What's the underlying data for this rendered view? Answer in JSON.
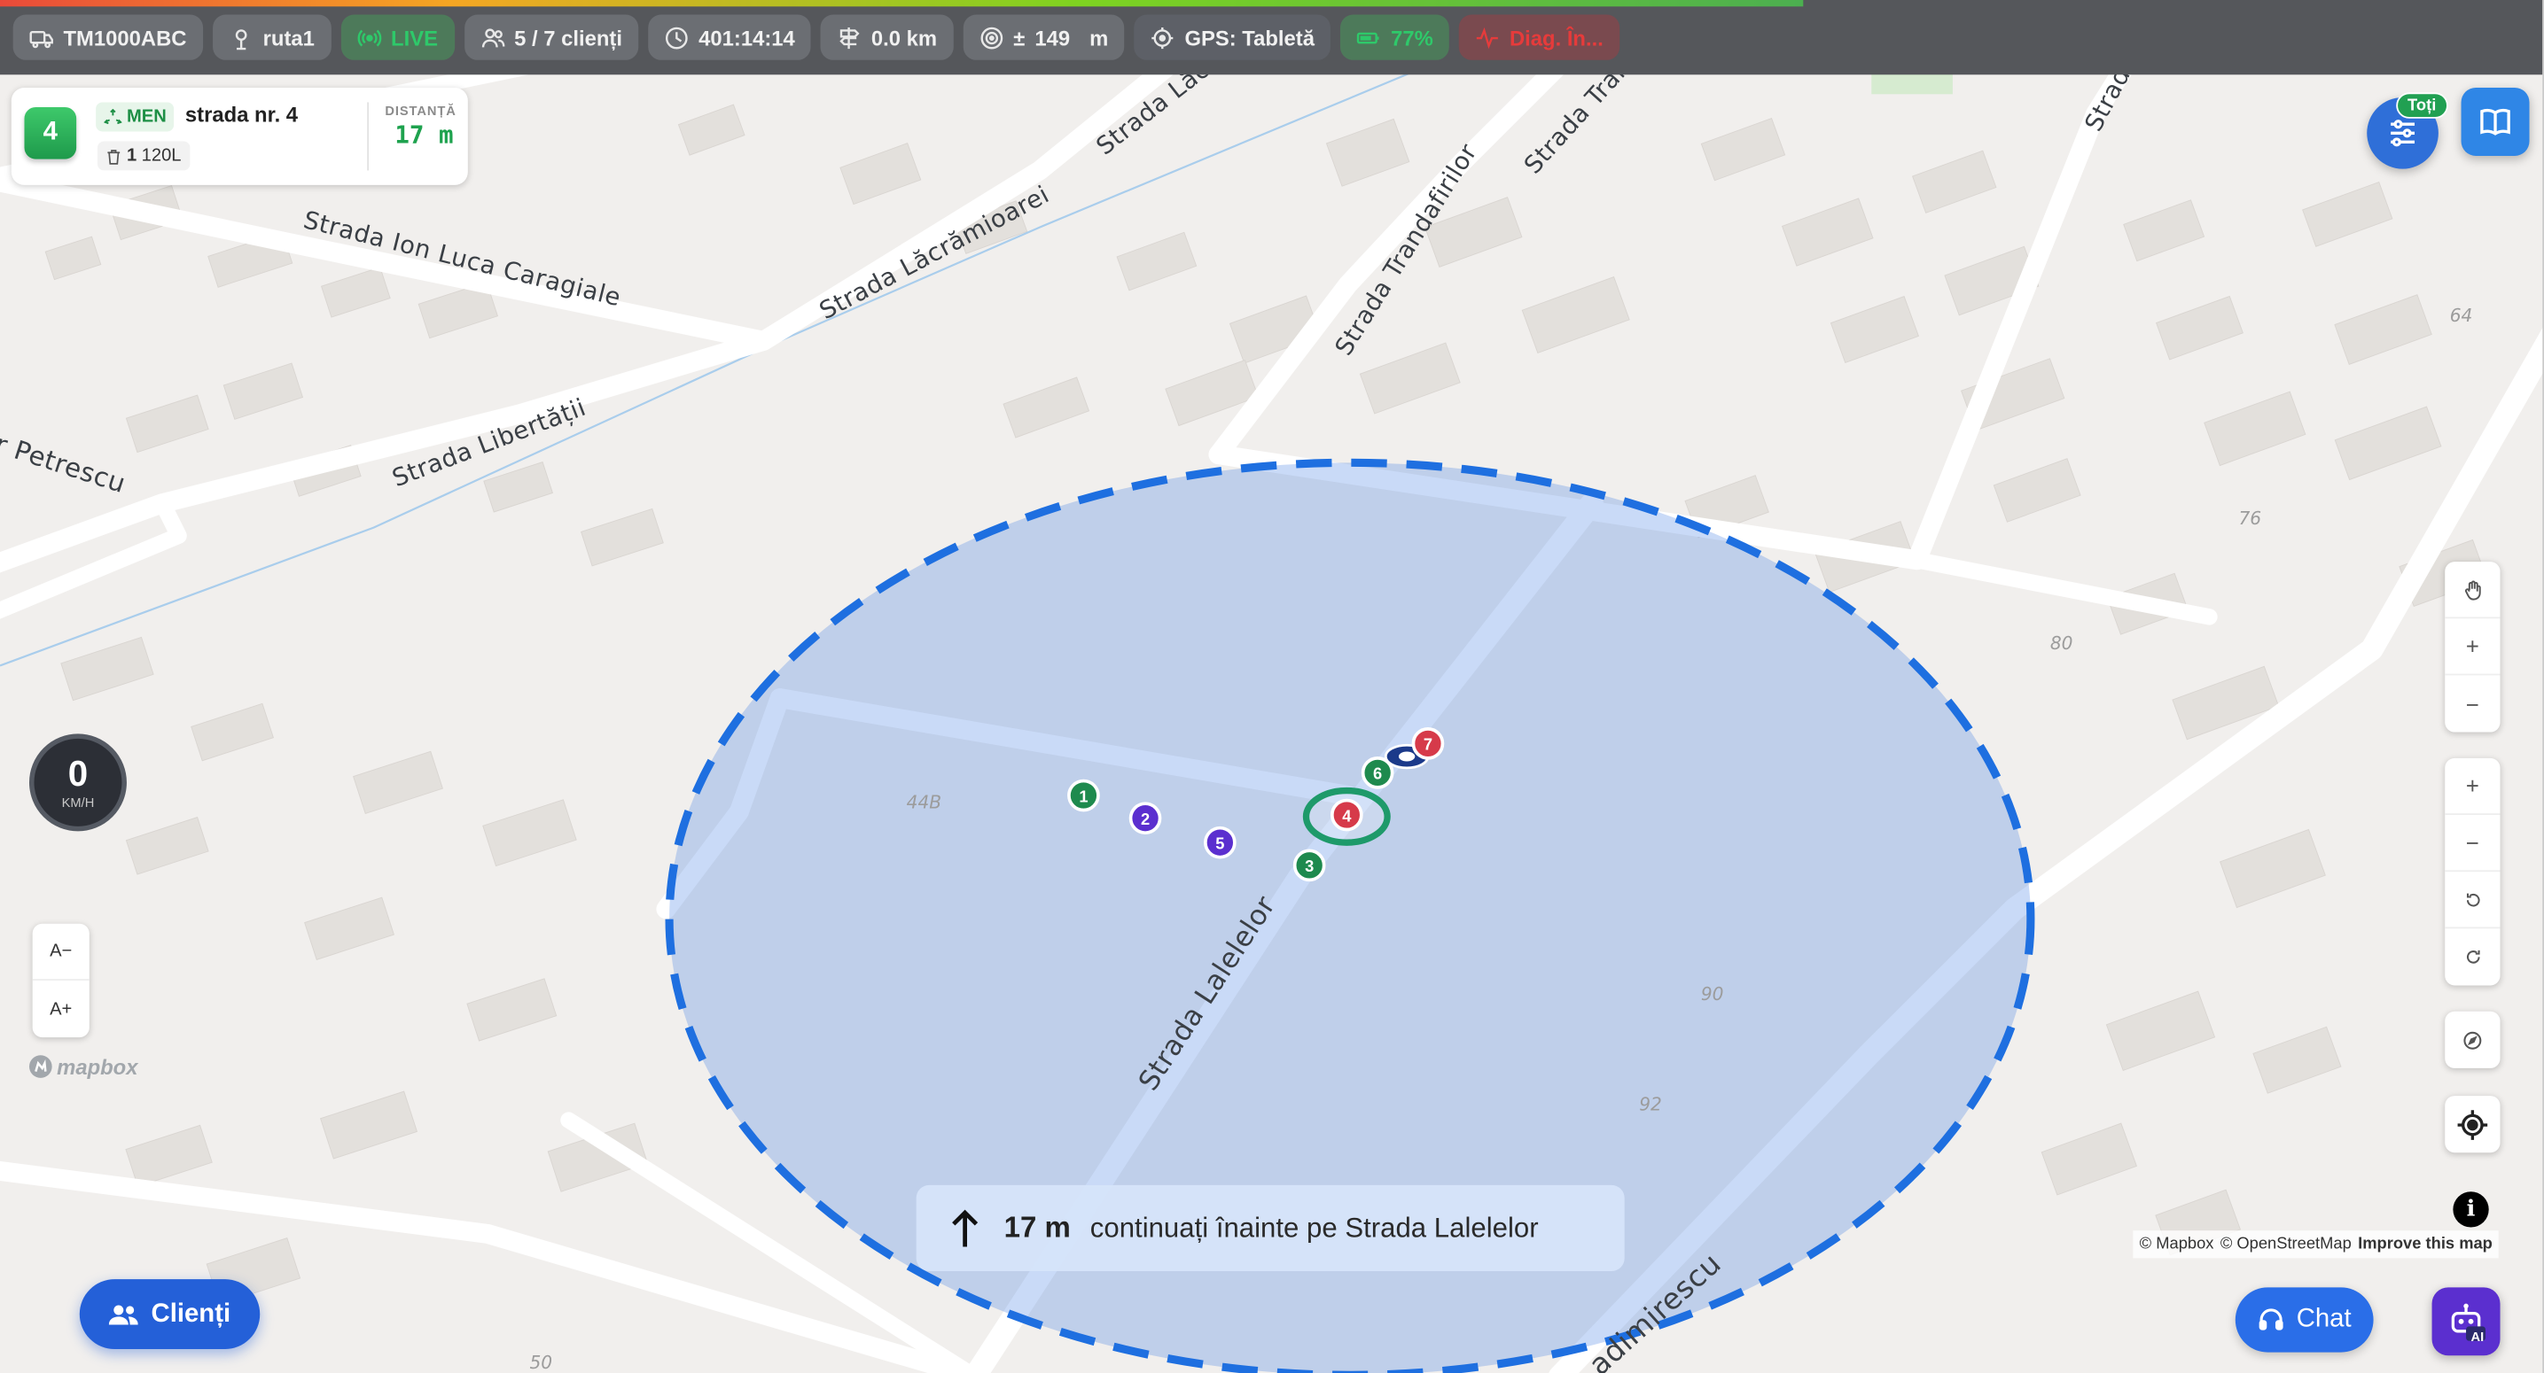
{
  "topbar": {
    "vehicle": "TM1000ABC",
    "route": "ruta1",
    "live": "LIVE",
    "clients": "5 / 7 clienți",
    "time": "401:14:14",
    "distance": "0.0 km",
    "accuracy_prefix": "±",
    "accuracy_value": "149",
    "accuracy_unit": "m",
    "gps": "GPS: Tabletă",
    "battery": "77%",
    "diag": "Diag. În..."
  },
  "client_card": {
    "number": "4",
    "type": "MEN",
    "street": "strada nr. 4",
    "bins": "1",
    "bin_size": "120L",
    "distance_label": "DISTANȚĂ",
    "distance_value": "17 m"
  },
  "controls": {
    "filter_badge": "Toți",
    "font_decrease": "A−",
    "font_increase": "A+"
  },
  "speed": {
    "value": "0",
    "unit": "KM/H"
  },
  "map": {
    "streets": [
      "Strada Ion Luca Caragiale",
      "Strada Lăcrămioarei",
      "Strada Libertății",
      "Strada Trandafirilor",
      "Strada Laleleor",
      "Petrescu",
      "adimirescu",
      "Strada Lăcr...",
      "Strada Trand...",
      "Strada"
    ],
    "street_ion": "Strada Ion Luca Caragiale",
    "street_lacr": "Strada Lăcrămioarei",
    "street_lacr_top": "Strada Lăcr",
    "street_lib": "Strada Libertății",
    "street_trand": "Strada Trandafirilor",
    "street_trand_top": "Strada Trand",
    "street_lalelelor": "Strada Lalelelor",
    "street_petrescu": "r Petrescu",
    "street_adimirescu": "adimirescu",
    "street_strada": "Strada",
    "house_numbers": [
      "44B",
      "90",
      "92",
      "80",
      "76",
      "64",
      "50"
    ],
    "markers": [
      {
        "label": "1",
        "color": "#1e8a4e"
      },
      {
        "label": "2",
        "color": "#5b2fcf"
      },
      {
        "label": "5",
        "color": "#5b2fcf"
      },
      {
        "label": "3",
        "color": "#1e8a4e"
      },
      {
        "label": "6",
        "color": "#1e8a4e"
      },
      {
        "label": "4",
        "color": "#d63a4a"
      },
      {
        "label": "7",
        "color": "#d63a4a"
      }
    ],
    "radius_color": "#1e6fe0",
    "attribution_mapbox": "© Mapbox",
    "attribution_osm": "© OpenStreetMap",
    "attribution_improve": "Improve this map",
    "logo": "mapbox"
  },
  "nav": {
    "distance": "17 m",
    "instruction": "continuați înainte pe Strada Lalelelor"
  },
  "buttons": {
    "clienti": "Clienți",
    "chat": "Chat",
    "ai": "AI"
  },
  "colors": {
    "topbar": "#55575b",
    "accent_blue": "#2460d8",
    "success": "#1ea24e",
    "danger": "#e63b3b"
  }
}
